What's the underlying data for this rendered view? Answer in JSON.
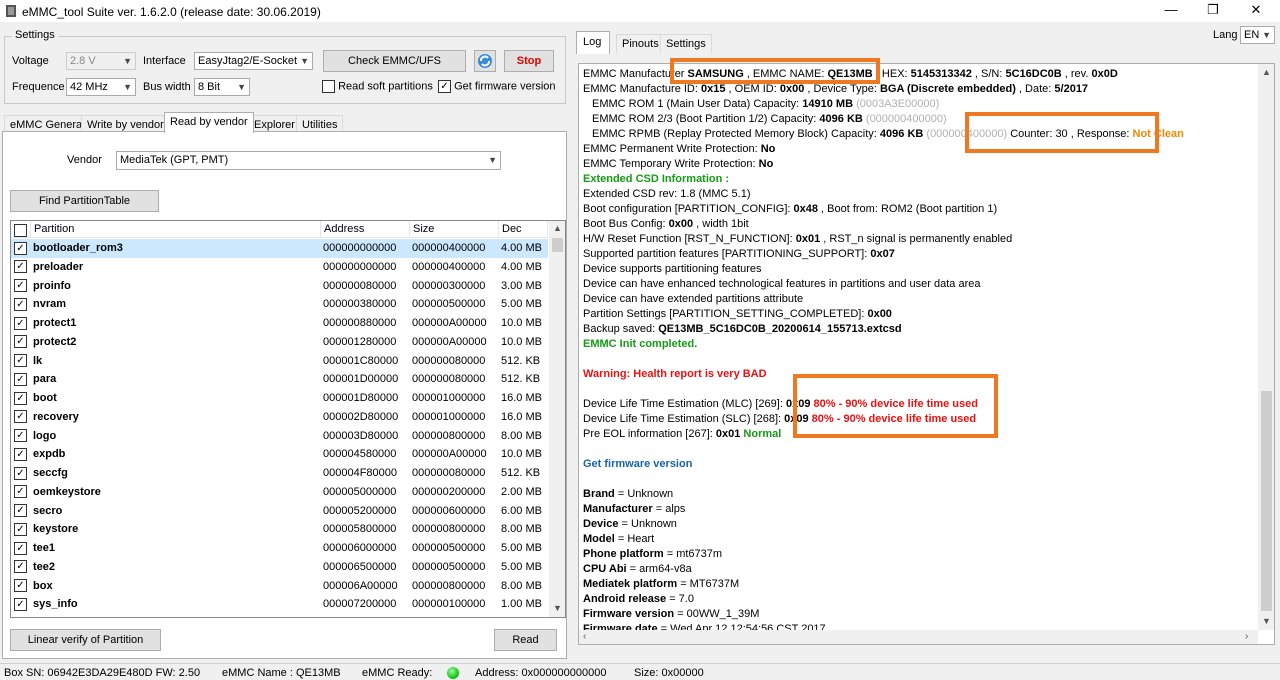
{
  "window": {
    "title": "eMMC_tool Suite  ver. 1.6.2.0 (release date: 30.06.2019)",
    "min": "—",
    "max": "❐",
    "close": "✕"
  },
  "settings": {
    "group_label": "Settings",
    "voltage_label": "Voltage",
    "voltage_value": "2.8 V",
    "interface_label": "Interface",
    "interface_value": "EasyJtag2/E-Socket",
    "check_button": "Check EMMC/UFS",
    "stop_button": "Stop",
    "frequence_label": "Frequence",
    "frequence_value": "42 MHz",
    "buswidth_label": "Bus width",
    "buswidth_value": "8 Bit",
    "read_soft_label": "Read soft partitions",
    "read_soft_checked": false,
    "get_fw_label": "Get firmware version",
    "get_fw_checked": true
  },
  "left_tabs": [
    "eMMC General",
    "Write by vendor",
    "Read by vendor",
    "Explorer",
    "Utilities"
  ],
  "vendor": {
    "label": "Vendor",
    "value": "MediaTek (GPT, PMT)"
  },
  "find_button": "Find PartitionTable",
  "table": {
    "headers": [
      "Partition",
      "Address",
      "Size",
      "Dec"
    ],
    "rows": [
      {
        "name": "bootloader_rom3",
        "address": "000000000000",
        "size": "000000400000",
        "dec": "4.00 MB"
      },
      {
        "name": "preloader",
        "address": "000000000000",
        "size": "000000400000",
        "dec": "4.00 MB"
      },
      {
        "name": "proinfo",
        "address": "000000080000",
        "size": "000000300000",
        "dec": "3.00 MB"
      },
      {
        "name": "nvram",
        "address": "000000380000",
        "size": "000000500000",
        "dec": "5.00 MB"
      },
      {
        "name": "protect1",
        "address": "000000880000",
        "size": "000000A00000",
        "dec": "10.0 MB"
      },
      {
        "name": "protect2",
        "address": "000001280000",
        "size": "000000A00000",
        "dec": "10.0 MB"
      },
      {
        "name": "lk",
        "address": "000001C80000",
        "size": "000000080000",
        "dec": "512. KB"
      },
      {
        "name": "para",
        "address": "000001D00000",
        "size": "000000080000",
        "dec": "512. KB"
      },
      {
        "name": "boot",
        "address": "000001D80000",
        "size": "000001000000",
        "dec": "16.0 MB"
      },
      {
        "name": "recovery",
        "address": "000002D80000",
        "size": "000001000000",
        "dec": "16.0 MB"
      },
      {
        "name": "logo",
        "address": "000003D80000",
        "size": "000000800000",
        "dec": "8.00 MB"
      },
      {
        "name": "expdb",
        "address": "000004580000",
        "size": "000000A00000",
        "dec": "10.0 MB"
      },
      {
        "name": "seccfg",
        "address": "000004F80000",
        "size": "000000080000",
        "dec": "512. KB"
      },
      {
        "name": "oemkeystore",
        "address": "000005000000",
        "size": "000000200000",
        "dec": "2.00 MB"
      },
      {
        "name": "secro",
        "address": "000005200000",
        "size": "000000600000",
        "dec": "6.00 MB"
      },
      {
        "name": "keystore",
        "address": "000005800000",
        "size": "000000800000",
        "dec": "8.00 MB"
      },
      {
        "name": "tee1",
        "address": "000006000000",
        "size": "000000500000",
        "dec": "5.00 MB"
      },
      {
        "name": "tee2",
        "address": "000006500000",
        "size": "000000500000",
        "dec": "5.00 MB"
      },
      {
        "name": "box",
        "address": "000006A00000",
        "size": "000000800000",
        "dec": "8.00 MB"
      },
      {
        "name": "sys_info",
        "address": "000007200000",
        "size": "000000100000",
        "dec": "1.00 MB"
      }
    ]
  },
  "linear_verify_button": "Linear verify of Partition",
  "read_button": "Read",
  "right_tabs": [
    "Log",
    "Pinouts",
    "Settings"
  ],
  "lang": {
    "label": "Lang",
    "value": "EN"
  },
  "log": {
    "l1": {
      "a": "EMMC Manufacturer ",
      "b": "SAMSUNG",
      "c": " , EMMC NAME: ",
      "d": "QE13MB",
      "e": " , HEX: ",
      "f": "5145313342",
      "g": " , S/N: ",
      "h": "5C16DC0B",
      "i": " , rev. ",
      "j": "0x0D"
    },
    "l2": {
      "a": "EMMC Manufacture ID: ",
      "b": "0x15",
      "c": " , OEM ID: ",
      "d": "0x00",
      "e": " , Device Type: ",
      "f": "BGA (Discrete embedded)",
      "g": " , Date: ",
      "h": "5/2017"
    },
    "l3": {
      "a": "EMMC ROM 1 (Main User Data) Capacity: ",
      "b": "14910 MB",
      "c": " (0003A3E00000)"
    },
    "l4": {
      "a": "EMMC ROM 2/3 (Boot Partition 1/2) Capacity: ",
      "b": "4096 KB",
      "c": " (000000400000)"
    },
    "l5": {
      "a": "EMMC RPMB (Replay Protected Memory Block) Capacity: ",
      "b": "4096 KB",
      "c": " (000000400000)",
      "d": " Counter: 30 , Response: ",
      "e": "Not Clean"
    },
    "l6": {
      "a": "EMMC Permanent Write Protection: ",
      "b": "No"
    },
    "l7": {
      "a": "EMMC Temporary Write Protection: ",
      "b": "No"
    },
    "l8": "Extended CSD Information :",
    "l9": "Extended CSD rev: 1.8 (MMC 5.1)",
    "l10": {
      "a": "Boot configuration [PARTITION_CONFIG]: ",
      "b": "0x48",
      "c": " , Boot from: ROM2 (Boot partition 1)"
    },
    "l11": {
      "a": "Boot Bus Config: ",
      "b": "0x00",
      "c": " , width 1bit"
    },
    "l12": {
      "a": "H/W Reset Function [RST_N_FUNCTION]: ",
      "b": "0x01",
      "c": " , RST_n signal is permanently enabled"
    },
    "l13": {
      "a": "Supported partition features [PARTITIONING_SUPPORT]: ",
      "b": "0x07"
    },
    "l14": "Device supports partitioning features",
    "l15": "Device can have enhanced technological features in partitions and user data area",
    "l16": "Device can have extended partitions attribute",
    "l17": {
      "a": "Partition Settings [PARTITION_SETTING_COMPLETED]: ",
      "b": "0x00"
    },
    "l18": {
      "a": "Backup saved: ",
      "b": "QE13MB_5C16DC0B_20200614_155713.extcsd"
    },
    "l19": "EMMC Init completed.",
    "l20": "Warning: Health report is very BAD",
    "l21": {
      "a": "Device Life Time Estimation (MLC) [269]: ",
      "b": "0x09",
      "c": "  80% - 90% device life time used"
    },
    "l22": {
      "a": "Device Life Time Estimation (SLC) [268]: ",
      "b": "0x09",
      "c": "  80% - 90% device life time used"
    },
    "l23": {
      "a": "Pre EOL information [267]: ",
      "b": "0x01",
      "c": "   Normal"
    },
    "l24": "Get firmware version",
    "l25": {
      "a": "Brand",
      "b": " = Unknown"
    },
    "l26": {
      "a": "Manufacturer",
      "b": " = alps"
    },
    "l27": {
      "a": "Device",
      "b": " = Unknown"
    },
    "l28": {
      "a": "Model",
      "b": " = Heart"
    },
    "l29": {
      "a": "Phone platform",
      "b": " = mt6737m"
    },
    "l30": {
      "a": "CPU Abi",
      "b": " = arm64-v8a"
    },
    "l31": {
      "a": "Mediatek platform",
      "b": " = MT6737M"
    },
    "l32": {
      "a": "Android release",
      "b": " = 7.0"
    },
    "l33": {
      "a": "Firmware version",
      "b": " = 00WW_1_39M"
    },
    "l34": {
      "a": "Firmware date",
      "b": " = Wed Apr 12 12:54:56 CST 2017"
    }
  },
  "status": {
    "box_sn": "Box SN:  06942E3DA29E480D  FW:  2.50",
    "emmc_name": "eMMC Name : QE13MB",
    "emmc_ready": "eMMC Ready:",
    "address": "Address: 0x000000000000",
    "size": "Size: 0x00000"
  },
  "colors": {
    "highlight": "#f07820",
    "ok": "#159b15",
    "bad": "#e81010",
    "link": "#1565a8",
    "warn": "#ee8800",
    "ready_led": "#22cc22"
  },
  "icons": [
    "app-icon",
    "refresh-icon",
    "dropdown-arrow-icon",
    "checkbox-icon",
    "scroll-up-icon",
    "scroll-down-icon",
    "led-icon"
  ]
}
